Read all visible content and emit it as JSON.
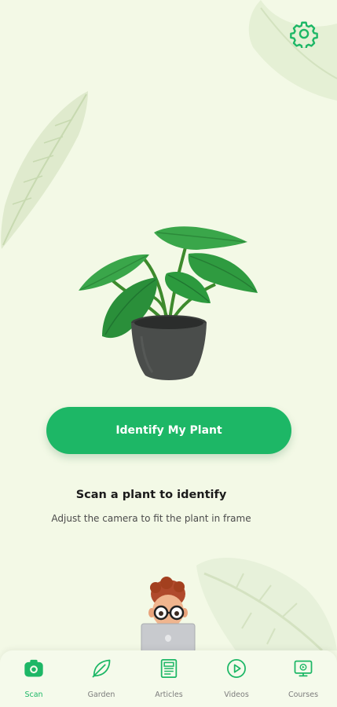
{
  "colors": {
    "background": "#f3f9e6",
    "accent": "#1db766",
    "nav_active": "#1db766",
    "nav_inactive": "#7c7c7c"
  },
  "header": {
    "settings_icon": "gear-icon"
  },
  "main": {
    "identify_button_label": "Identify My Plant",
    "heading": "Scan a plant to identify",
    "subheading": "Adjust the camera to fit the plant in frame"
  },
  "bottom_nav": {
    "active": "scan",
    "items": [
      {
        "id": "scan",
        "label": "Scan",
        "icon": "camera-icon"
      },
      {
        "id": "garden",
        "label": "Garden",
        "icon": "leaf-icon"
      },
      {
        "id": "articles",
        "label": "Articles",
        "icon": "article-icon"
      },
      {
        "id": "videos",
        "label": "Videos",
        "icon": "play-icon"
      },
      {
        "id": "courses",
        "label": "Courses",
        "icon": "courses-icon"
      }
    ]
  }
}
